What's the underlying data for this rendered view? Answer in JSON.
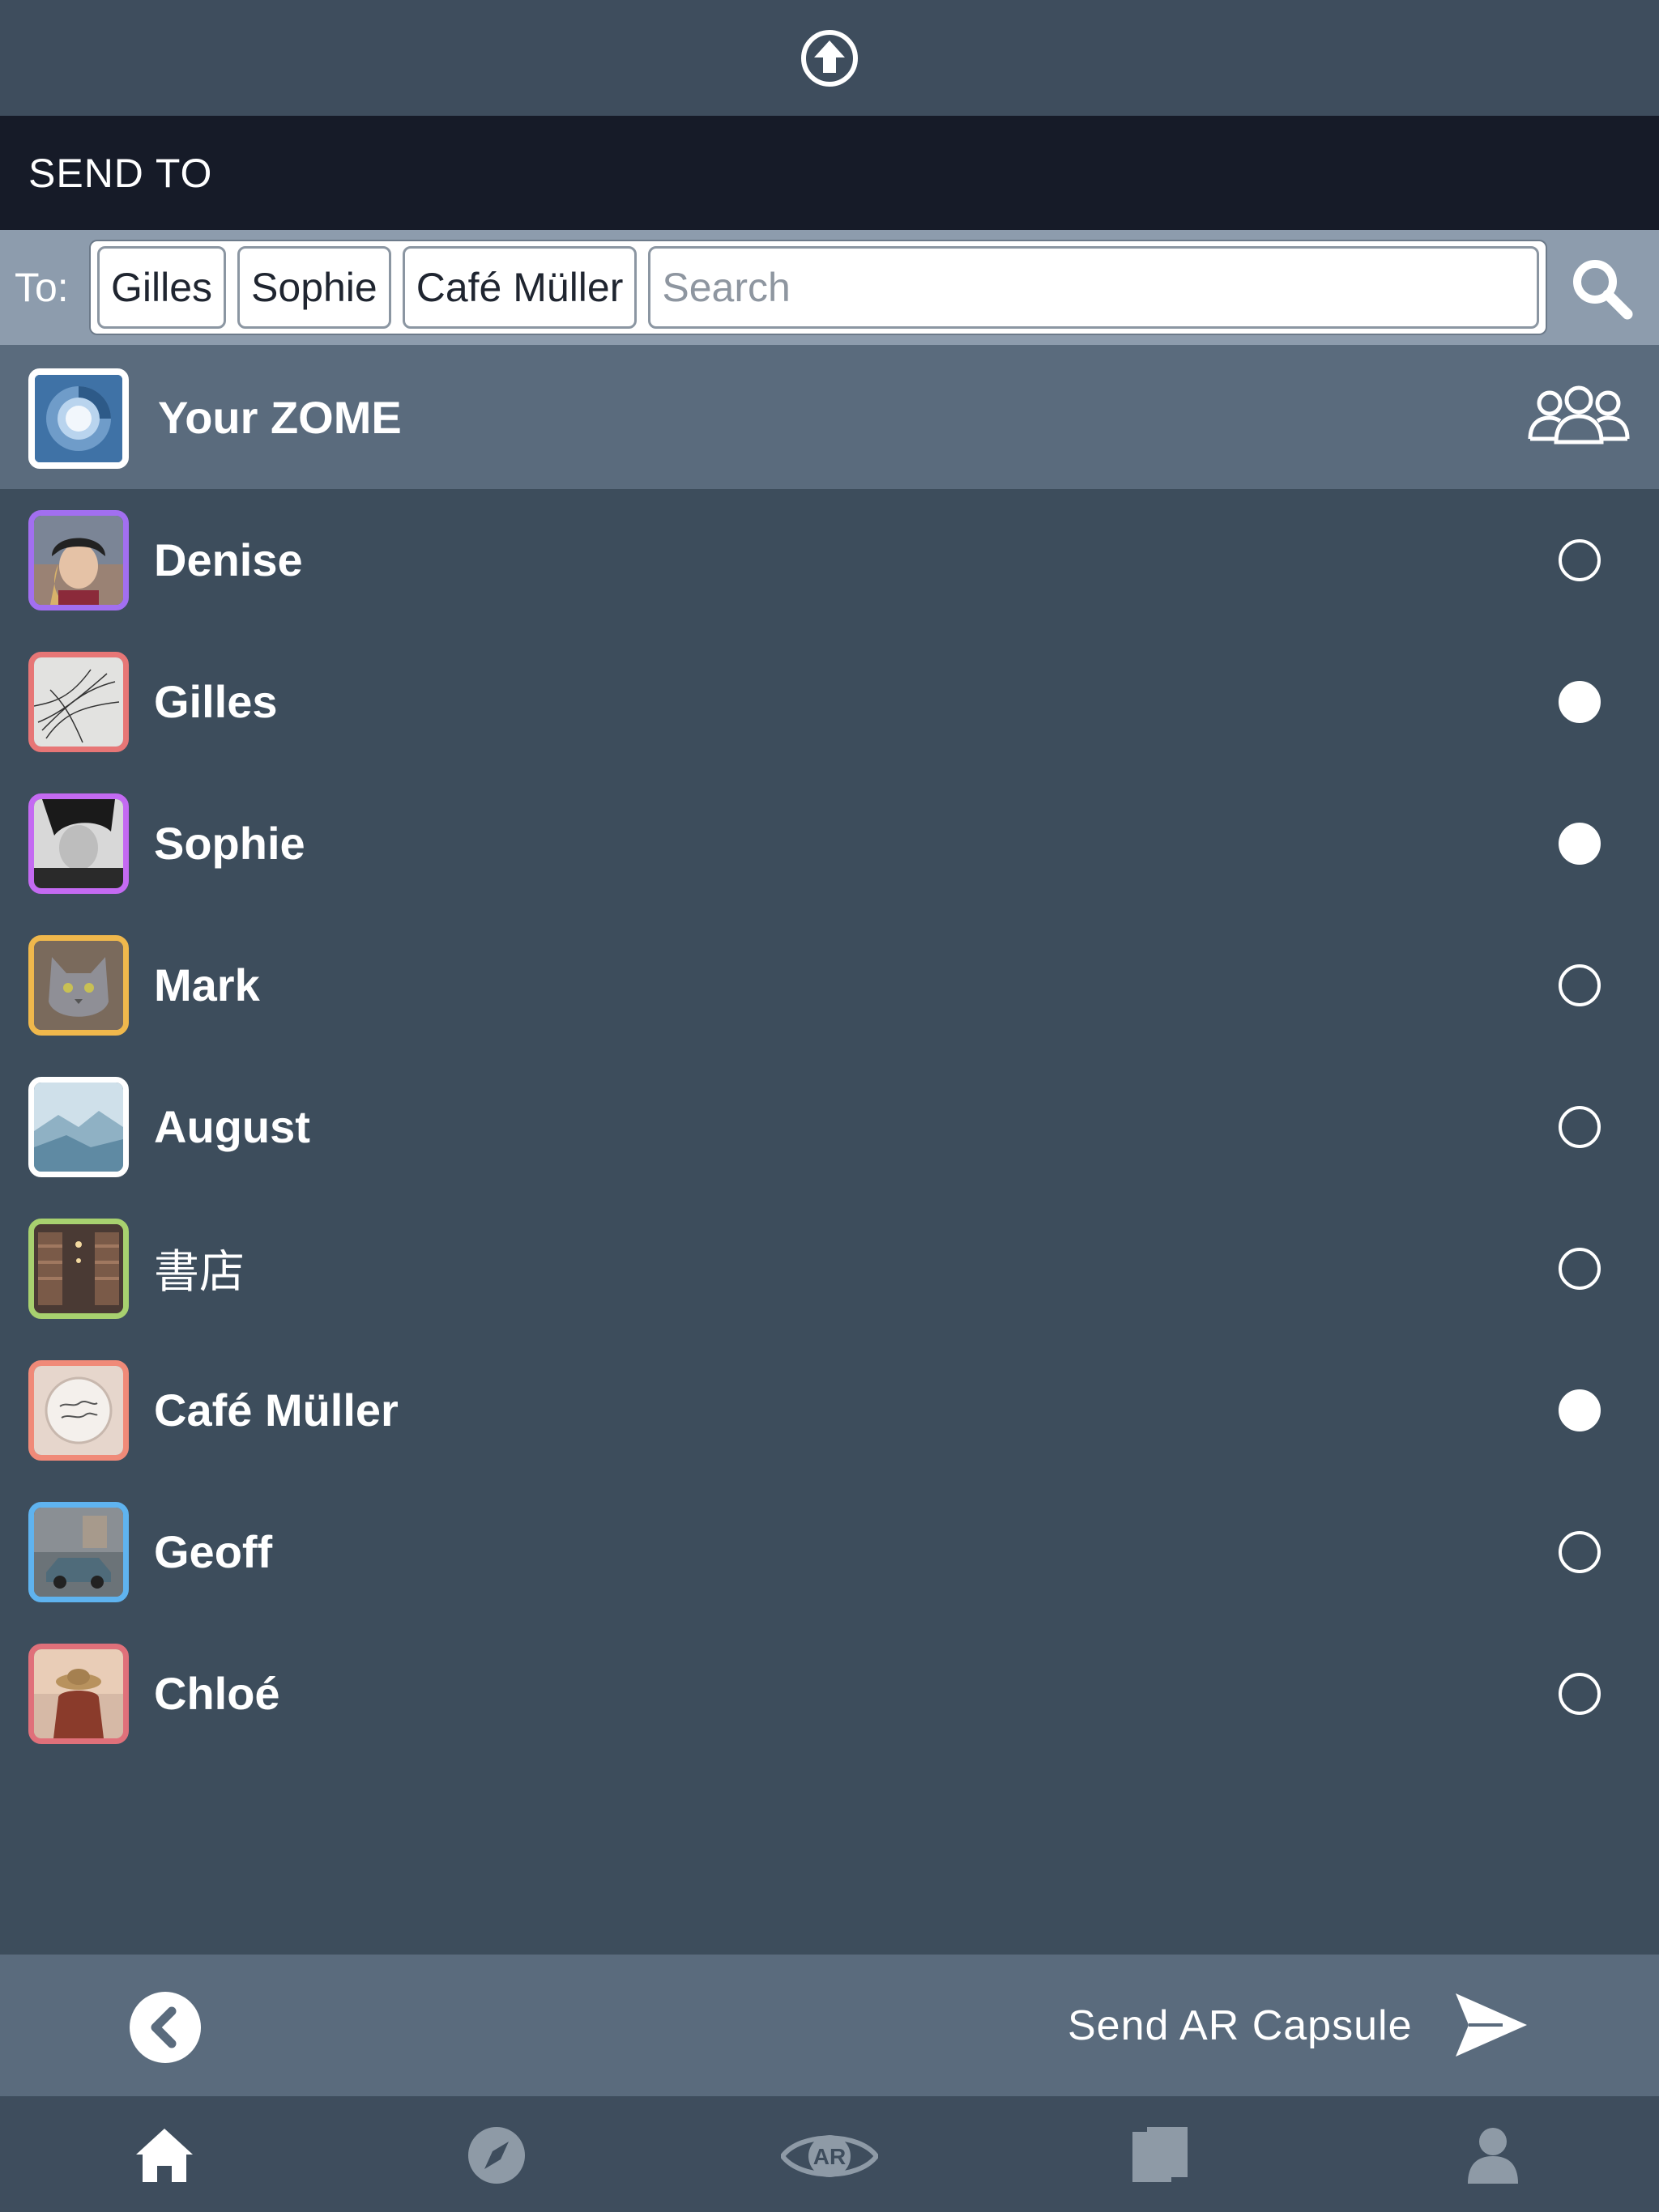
{
  "header": {
    "upload_icon": "upload-circle-icon"
  },
  "title": "SEND TO",
  "to_bar": {
    "label": "To:",
    "chips": [
      "Gilles",
      "Sophie",
      "Café Müller"
    ],
    "search_placeholder": "Search",
    "search_icon": "search-icon"
  },
  "zome": {
    "label": "Your ZOME",
    "group_icon": "group-icon"
  },
  "contacts": [
    {
      "name": "Denise",
      "selected": false,
      "border": "#a26ff0"
    },
    {
      "name": "Gilles",
      "selected": true,
      "border": "#e77676"
    },
    {
      "name": "Sophie",
      "selected": true,
      "border": "#c46af2"
    },
    {
      "name": "Mark",
      "selected": false,
      "border": "#f0b84c"
    },
    {
      "name": "August",
      "selected": false,
      "border": "#ffffff"
    },
    {
      "name": "書店",
      "selected": false,
      "border": "#a8d16f"
    },
    {
      "name": "Café Müller",
      "selected": true,
      "border": "#f08a78"
    },
    {
      "name": "Geoff",
      "selected": false,
      "border": "#5fb3ef"
    },
    {
      "name": "Chloé",
      "selected": false,
      "border": "#e0707a"
    }
  ],
  "action_bar": {
    "send_label": "Send AR Capsule"
  },
  "tab_bar": {
    "tabs": [
      "home-icon",
      "compass-icon",
      "ar-eye-icon",
      "cards-icon",
      "profile-icon"
    ],
    "ar_label": "AR"
  },
  "colors": {
    "background": "#3d4d5c",
    "title_bar": "#161b28",
    "to_bar": "#8d9cad",
    "highlight_row": "#5a6b7d"
  }
}
